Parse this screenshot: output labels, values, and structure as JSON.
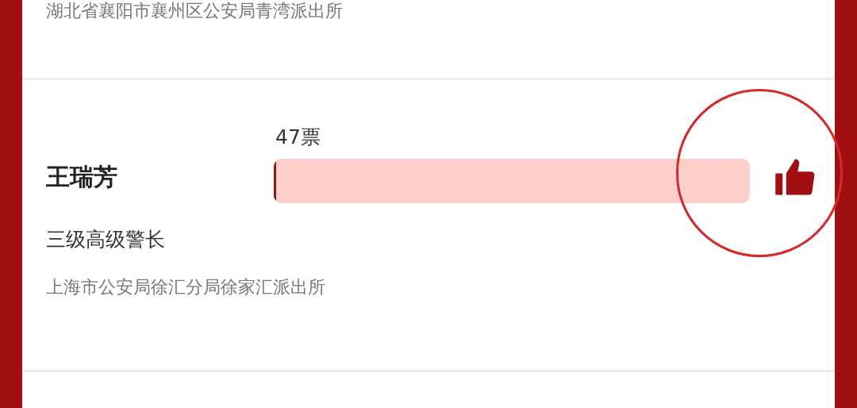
{
  "previous_entry": {
    "organization": "湖北省襄阳市襄州区公安局青湾派出所"
  },
  "candidate": {
    "name": "王瑞芳",
    "votes": "47票",
    "level": 0.005,
    "rank": "三级高级警长",
    "organization": "上海市公安局徐汇分局徐家汇派出所",
    "liked": true
  }
}
